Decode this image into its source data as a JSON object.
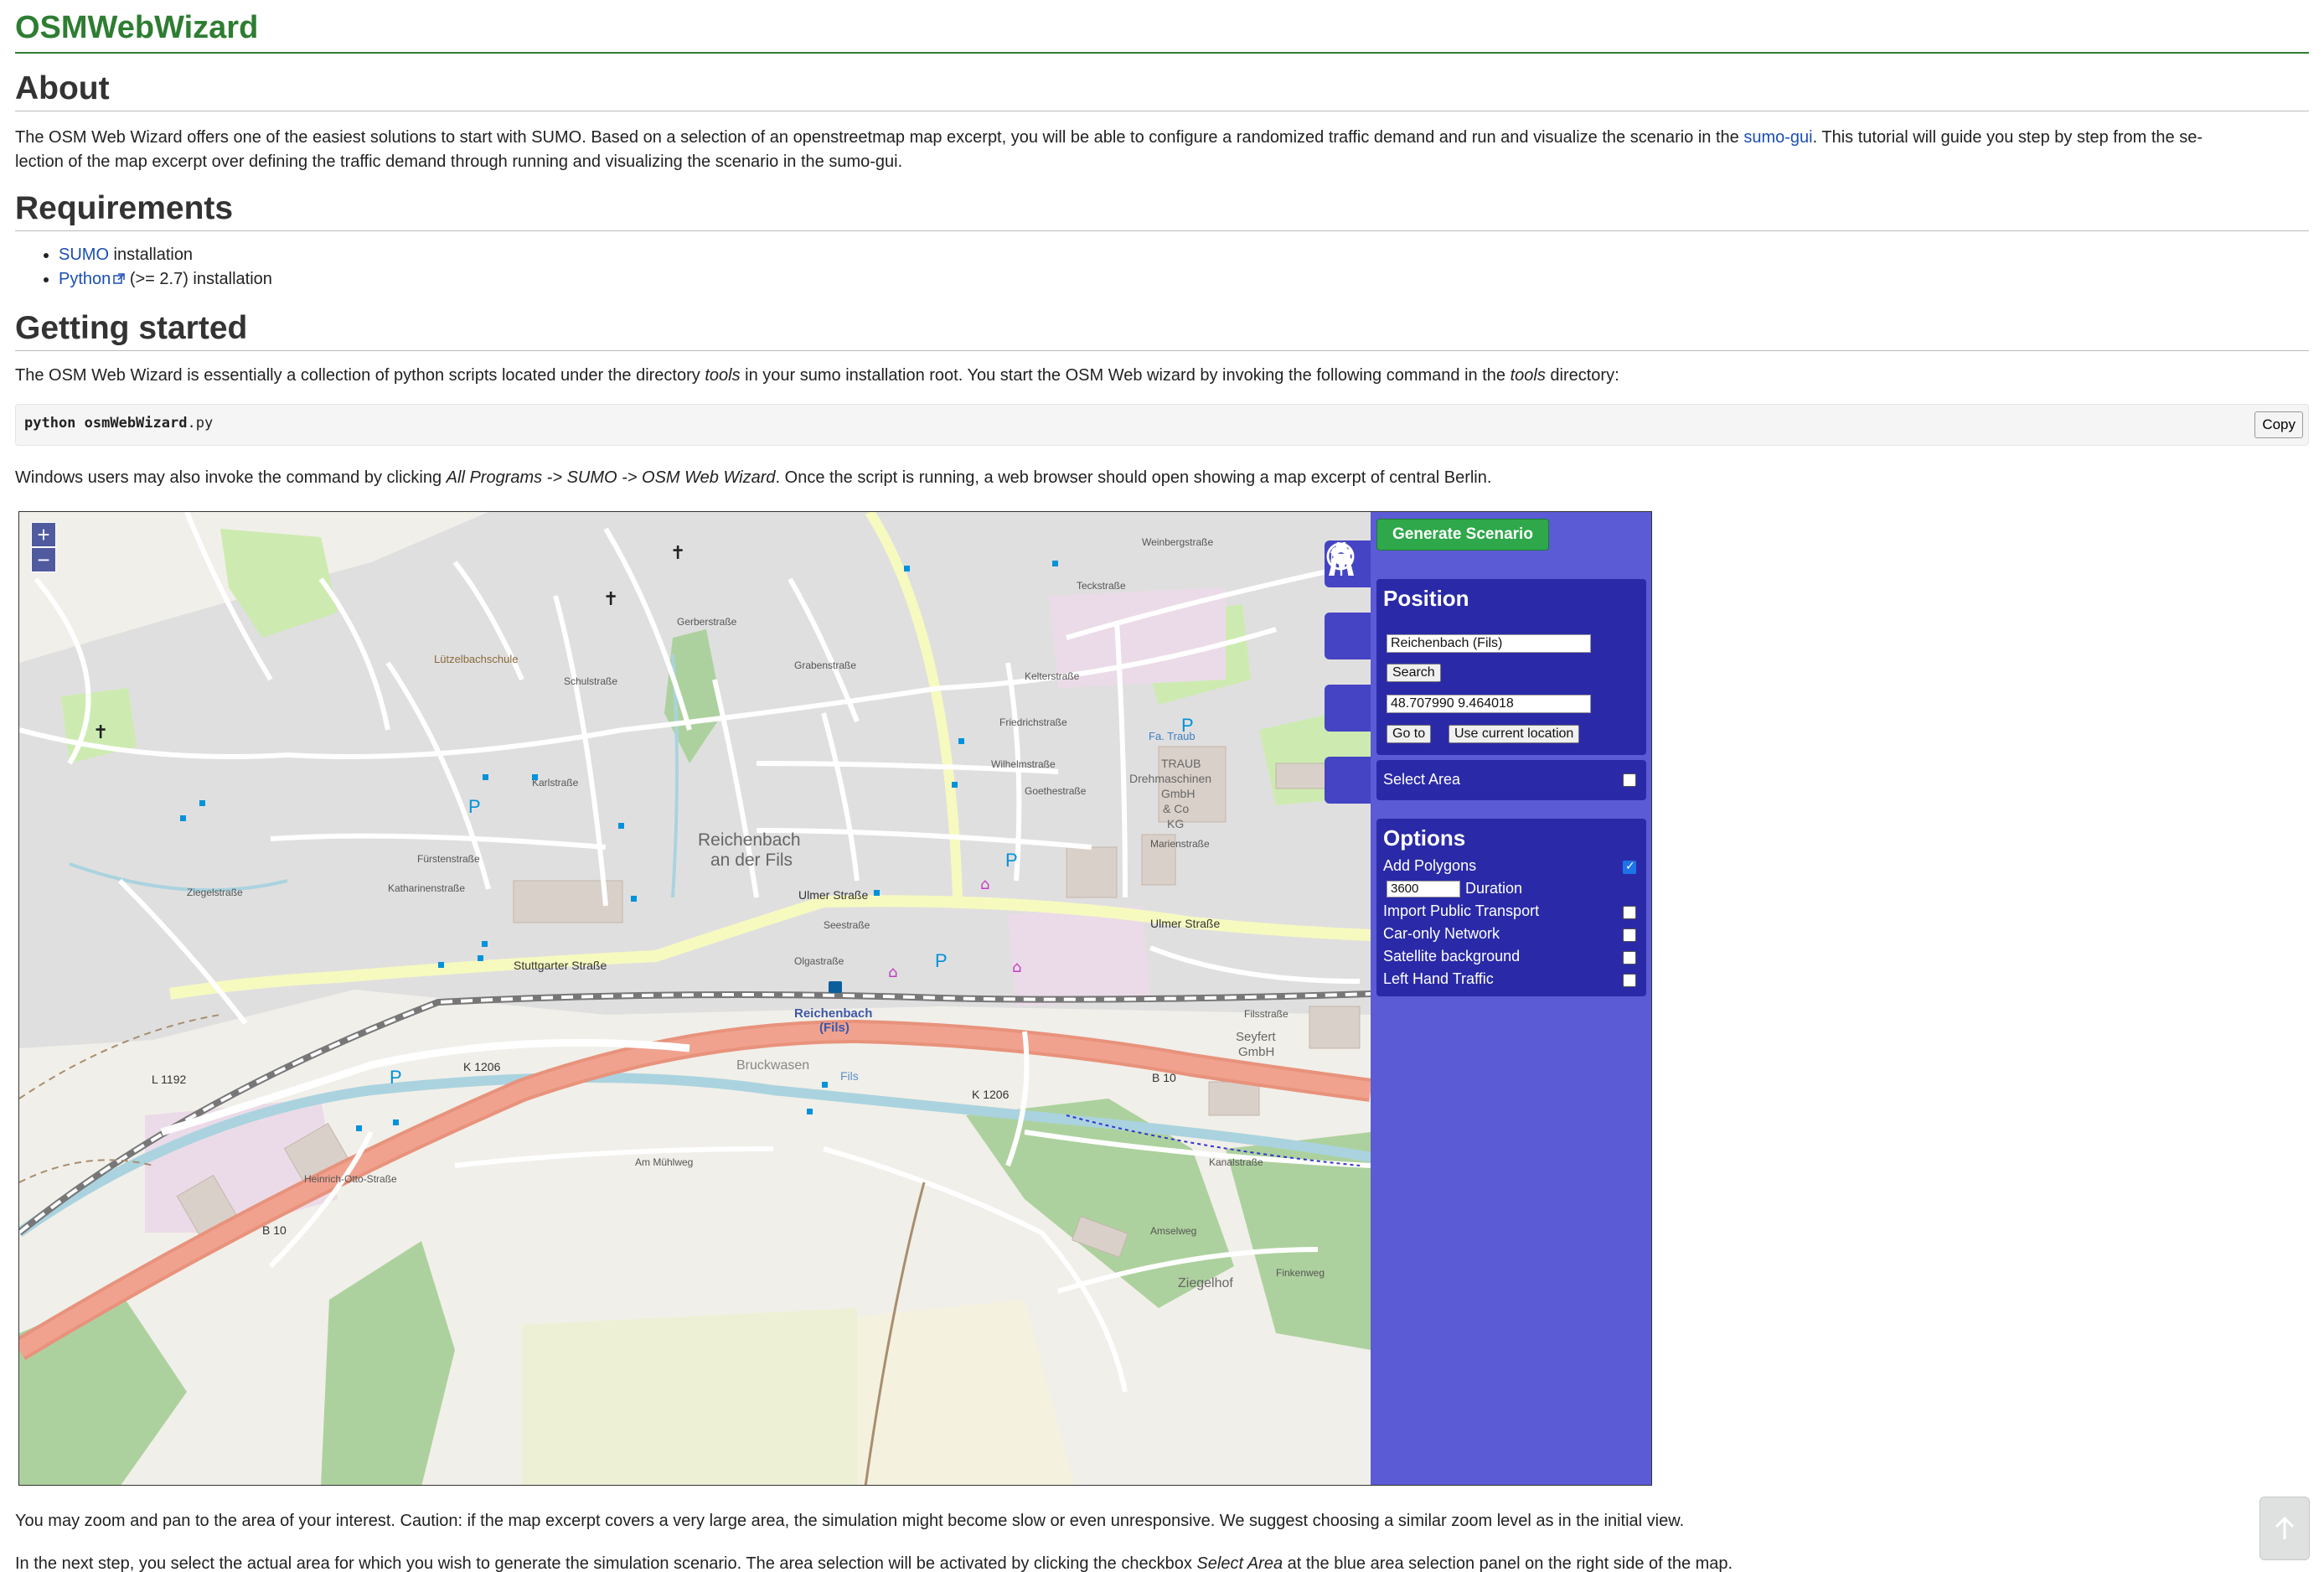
{
  "site_title": "OSMWebWizard",
  "about": {
    "heading": "About",
    "text_before_link": "The OSM Web Wizard offers one of the easiest solutions to start with SUMO. Based on a selection of an openstreetmap map excerpt, you will be able to configure a randomized traffic demand and run and visualize the scenario in the ",
    "link": "sumo-gui",
    "text_after_link": ". This tutorial will guide you step by step from the se-",
    "line2": "lection of the map excerpt over defining the traffic demand through running and visualizing the scenario in the sumo-gui."
  },
  "requirements": {
    "heading": "Requirements",
    "items": [
      {
        "link": "SUMO",
        "rest": " installation"
      },
      {
        "link": "Python",
        "rest": " (>= 2.7) installation",
        "external_icon": "external-link-icon"
      }
    ]
  },
  "getting_started": {
    "heading": "Getting started",
    "p1_a": "The OSM Web Wizard is essentially a collection of python scripts located under the directory ",
    "p1_tools1": "tools",
    "p1_b": " in your sumo installation root. You start the OSM Web wizard by invoking the following command in the ",
    "p1_tools2": "tools",
    "p1_c": " directory:",
    "code_bold": "python osmWebWizard",
    "code_rest": ".py",
    "copy_label": "Copy",
    "p2_a": "Windows users may also invoke the command by clicking ",
    "p2_path": "All Programs -> SUMO -> OSM Web Wizard",
    "p2_b": ". Once the script is running, a web browser should open showing a map excerpt of central Berlin."
  },
  "map": {
    "zoom_in": "+",
    "zoom_out": "−",
    "labels": {
      "town": "Reichenbach",
      "town2": "an der Fils",
      "station": "Reichenbach",
      "station2": "(Fils)",
      "ulmer1": "Ulmer Straße",
      "ulmer2": "Ulmer Straße",
      "stuttgarter": "Stuttgarter Straße",
      "b10a": "B 10",
      "b10b": "B 10",
      "k1206a": "K 1206",
      "k1206b": "K 1206",
      "l1192": "L 1192",
      "bruckwasen": "Bruckwasen",
      "seyfert": "Seyfert",
      "seyfert2": "GmbH",
      "traub1": "TRAUB",
      "traub2": "Drehmaschinen",
      "traub3": "GmbH",
      "traub4": "& Co",
      "traub5": "KG",
      "fatraub": "Fa. Traub",
      "ziegelhof": "Ziegelhof",
      "luetzel": "Lützelbachschule",
      "karlstr": "Karlstraße",
      "marienstr": "Marienstraße",
      "wilhelmstr": "Wilhelmstraße",
      "weinberg": "Weinbergstraße",
      "kanalstr": "Kanalstraße",
      "heinrich": "Heinrich-Otto-Straße",
      "fils": "Fils",
      "olgastr": "Olgastraße",
      "fuerstenstr": "Fürstenstraße",
      "katharinen": "Katharinenstraße",
      "seestr": "Seestraße",
      "amseiweg": "Amselweg",
      "finkenweg": "Finkenweg",
      "ammuehlweg": "Am Mühlweg",
      "friedrich": "Friedrichstraße",
      "grabenstr": "Grabenstraße",
      "schulstr": "Schulstraße",
      "gerberstr": "Gerberstraße",
      "teckstr": "Teckstraße",
      "ziegelstr": "Ziegelstraße",
      "filsstr": "Filsstraße",
      "goethe": "Goethestraße",
      "keilerstr": "Kelterstraße"
    }
  },
  "panel": {
    "generate": "Generate Scenario",
    "position_heading": "Position",
    "place_value": "Reichenbach (Fils)",
    "search": "Search",
    "coords_value": "48.707990 9.464018",
    "goto": "Go to",
    "use_location": "Use current location",
    "select_area": "Select Area",
    "options_heading": "Options",
    "add_polygons": "Add Polygons",
    "duration_value": "3600",
    "duration_label": "Duration",
    "import_pt": "Import Public Transport",
    "car_only": "Car-only Network",
    "satellite": "Satellite background",
    "left_hand": "Left Hand Traffic",
    "icons": [
      "gear-icon",
      "car-icon",
      "road-icon",
      "copyright-icon"
    ],
    "add_polygons_checked": true
  },
  "footer": {
    "p3": "You may zoom and pan to the area of your interest. Caution: if the map excerpt covers a very large area, the simulation might become slow or even unresponsive. We suggest choosing a similar zoom level as in the initial view.",
    "p4_a": "In the next step, you select the actual area for which you wish to generate the simulation scenario. The area selection will be activated by clicking the checkbox ",
    "p4_sel": "Select Area",
    "p4_b": " at the blue area selection panel on the right side of the map.",
    "scroll_top": "arrow-up-icon"
  }
}
